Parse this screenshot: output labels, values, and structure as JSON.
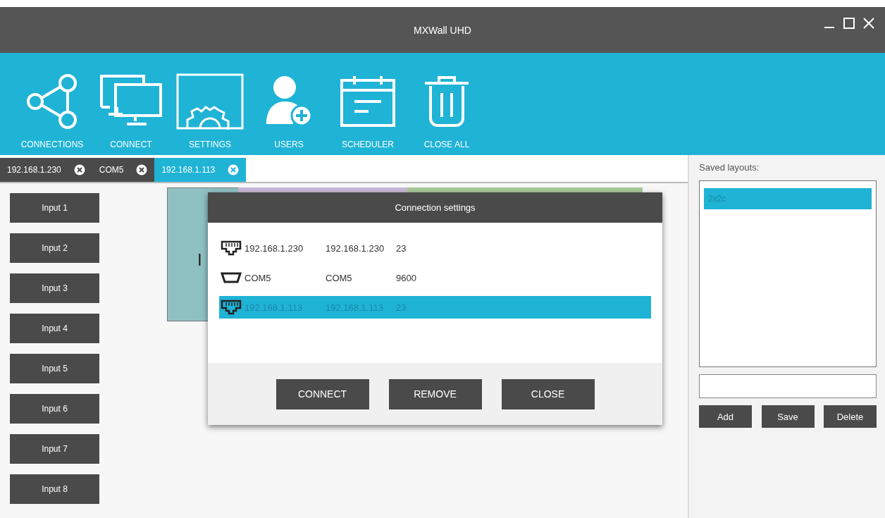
{
  "window": {
    "title": "MXWall UHD"
  },
  "toolbar": [
    {
      "kind": "connections",
      "label": "CONNECTIONS"
    },
    {
      "kind": "connect",
      "label": "CONNECT"
    },
    {
      "kind": "settings",
      "label": "SETTINGS"
    },
    {
      "kind": "users",
      "label": "USERS"
    },
    {
      "kind": "scheduler",
      "label": "SCHEDULER"
    },
    {
      "kind": "close_all",
      "label": "CLOSE ALL"
    }
  ],
  "tabs": [
    {
      "label": "192.168.1.230",
      "selected": false
    },
    {
      "label": "COM5",
      "selected": false
    },
    {
      "label": "192.168.1.113",
      "selected": true
    }
  ],
  "inputs": [
    "Input 1",
    "Input 2",
    "Input 3",
    "Input 4",
    "Input 5",
    "Input 6",
    "Input 7",
    "Input 8"
  ],
  "canvas": {
    "window_text": "I"
  },
  "dialog": {
    "title": "Connection settings",
    "connections": [
      {
        "kind": "ethernet",
        "name": "192.168.1.230",
        "address": "192.168.1.230",
        "port": "23",
        "selected": false
      },
      {
        "kind": "serial",
        "name": "COM5",
        "address": "COM5",
        "port": "9600",
        "selected": false
      },
      {
        "kind": "ethernet",
        "name": "192.168.1.113",
        "address": "192.168.1.113",
        "port": "23",
        "selected": true
      }
    ],
    "buttons": [
      "CONNECT",
      "REMOVE",
      "CLOSE"
    ]
  },
  "layouts_panel": {
    "label": "Saved layouts:",
    "layouts": [
      {
        "name": "2x2c",
        "selected": true
      }
    ],
    "buttons": [
      "Add",
      "Save",
      "Delete"
    ]
  }
}
